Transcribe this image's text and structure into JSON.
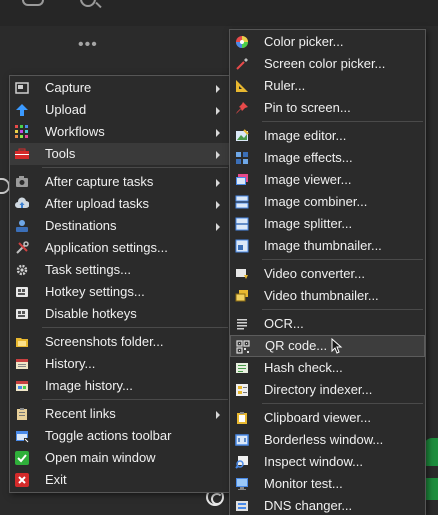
{
  "main_menu": {
    "items": [
      {
        "label": "Capture",
        "icon": "capture-icon",
        "submenu": true
      },
      {
        "label": "Upload",
        "icon": "upload-icon",
        "submenu": true
      },
      {
        "label": "Workflows",
        "icon": "workflows-icon",
        "submenu": true
      },
      {
        "label": "Tools",
        "icon": "tools-icon",
        "submenu": true
      },
      {
        "label": "After capture tasks",
        "icon": "after-capture-icon",
        "submenu": true
      },
      {
        "label": "After upload tasks",
        "icon": "after-upload-icon",
        "submenu": true
      },
      {
        "label": "Destinations",
        "icon": "destinations-icon",
        "submenu": true
      },
      {
        "label": "Application settings...",
        "icon": "application-settings-icon"
      },
      {
        "label": "Task settings...",
        "icon": "task-settings-icon"
      },
      {
        "label": "Hotkey settings...",
        "icon": "hotkey-settings-icon"
      },
      {
        "label": "Disable hotkeys",
        "icon": "disable-hotkeys-icon"
      },
      {
        "label": "Screenshots folder...",
        "icon": "screenshots-folder-icon"
      },
      {
        "label": "History...",
        "icon": "history-icon"
      },
      {
        "label": "Image history...",
        "icon": "image-history-icon"
      },
      {
        "label": "Recent links",
        "icon": "recent-links-icon",
        "submenu": true
      },
      {
        "label": "Toggle actions toolbar",
        "icon": "toggle-toolbar-icon"
      },
      {
        "label": "Open main window",
        "icon": "open-main-window-icon"
      },
      {
        "label": "Exit",
        "icon": "exit-icon"
      }
    ]
  },
  "tools_menu": {
    "items": [
      {
        "label": "Color picker...",
        "icon": "color-picker-icon"
      },
      {
        "label": "Screen color picker...",
        "icon": "screen-color-picker-icon"
      },
      {
        "label": "Ruler...",
        "icon": "ruler-icon"
      },
      {
        "label": "Pin to screen...",
        "icon": "pin-icon"
      },
      {
        "label": "Image editor...",
        "icon": "image-editor-icon"
      },
      {
        "label": "Image effects...",
        "icon": "image-effects-icon"
      },
      {
        "label": "Image viewer...",
        "icon": "image-viewer-icon"
      },
      {
        "label": "Image combiner...",
        "icon": "image-combiner-icon"
      },
      {
        "label": "Image splitter...",
        "icon": "image-splitter-icon"
      },
      {
        "label": "Image thumbnailer...",
        "icon": "image-thumbnailer-icon"
      },
      {
        "label": "Video converter...",
        "icon": "video-converter-icon"
      },
      {
        "label": "Video thumbnailer...",
        "icon": "video-thumbnailer-icon"
      },
      {
        "label": "OCR...",
        "icon": "ocr-icon"
      },
      {
        "label": "QR code...",
        "icon": "qr-code-icon"
      },
      {
        "label": "Hash check...",
        "icon": "hash-check-icon"
      },
      {
        "label": "Directory indexer...",
        "icon": "directory-indexer-icon"
      },
      {
        "label": "Clipboard viewer...",
        "icon": "clipboard-viewer-icon"
      },
      {
        "label": "Borderless window...",
        "icon": "borderless-window-icon"
      },
      {
        "label": "Inspect window...",
        "icon": "inspect-window-icon"
      },
      {
        "label": "Monitor test...",
        "icon": "monitor-test-icon"
      },
      {
        "label": "DNS changer...",
        "icon": "dns-changer-icon"
      }
    ]
  },
  "colors": {
    "menu_bg": "#2b2b2b",
    "menu_border": "#565656",
    "hover_bg": "#3d3d3d",
    "text": "#f0f0f0",
    "accent_green": "#1e8e3e"
  }
}
